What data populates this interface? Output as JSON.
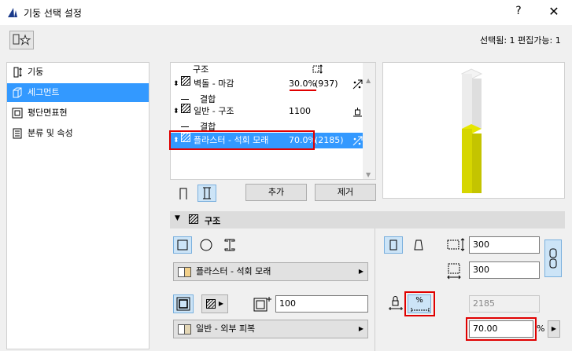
{
  "window": {
    "title": "기둥 선택 설정",
    "help": "?",
    "close": "✕"
  },
  "selection_info": "선택됨: 1 편집가능: 1",
  "sidebar": {
    "items": [
      {
        "label": "기둥"
      },
      {
        "label": "세그먼트"
      },
      {
        "label": "평단면표현"
      },
      {
        "label": "분류 및 속성"
      }
    ]
  },
  "tree": {
    "header_label": "구조",
    "rows": [
      {
        "name": "벽돌 - 마감",
        "value": "30.0%",
        "extra": "(937)"
      },
      {
        "name": "결합"
      },
      {
        "name": "일반 - 구조",
        "value": "1100"
      },
      {
        "name": "결합"
      },
      {
        "name": "플라스터 - 석회 모래",
        "value": "70.0%",
        "extra": "(2185)"
      }
    ]
  },
  "buttons": {
    "add": "추가",
    "remove": "제거"
  },
  "section": {
    "title": "구조"
  },
  "panel": {
    "material1": "플라스터 - 석회 모래",
    "material2": "일반 - 외부 피복",
    "core_value": "100",
    "width": "300",
    "depth": "300",
    "length_value": "2185",
    "percent_value": "70.00",
    "percent_unit": "%",
    "percent_btn_label": "%"
  }
}
